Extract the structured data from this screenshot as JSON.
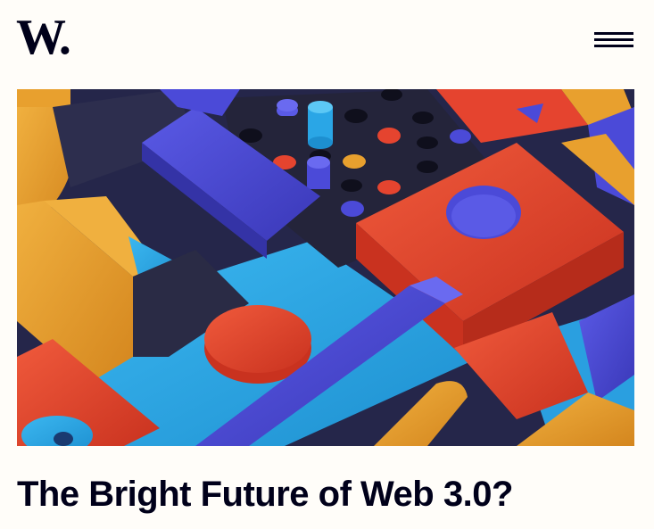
{
  "site": {
    "logo_text": "W."
  },
  "header": {
    "menu_icon": "hamburger-menu-icon"
  },
  "article": {
    "hero_image": "abstract-3d-blocks-illustration",
    "title": "The Bright Future of Web 3.0?"
  },
  "colors": {
    "page_background": "#fffdf9",
    "text": "#00001a",
    "block_orange": "#e8a02e",
    "block_red": "#e5442f",
    "block_blue": "#4b4ad8",
    "block_cyan": "#2aa6e6",
    "block_dark": "#2a2b45"
  }
}
